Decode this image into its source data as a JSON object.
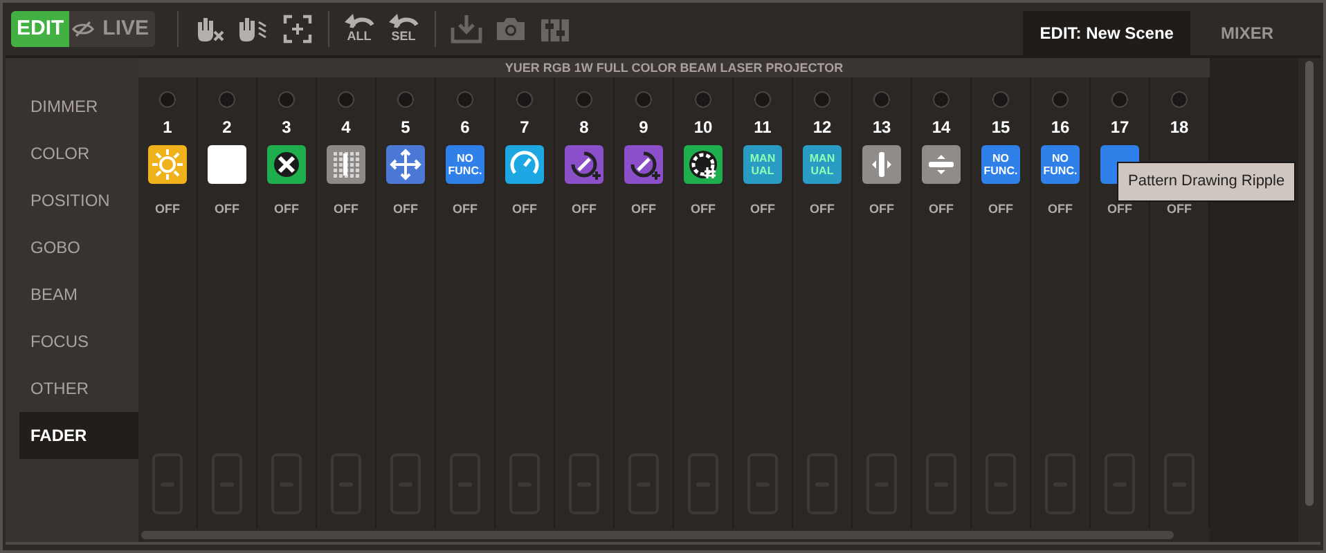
{
  "mode_toggle": [
    {
      "label": "EDIT",
      "kind": "edit",
      "selected": true
    },
    {
      "label": "LIVE",
      "kind": "live",
      "selected": false
    }
  ],
  "toolbar": [
    {
      "kind": "hand-x",
      "disabled": false
    },
    {
      "kind": "hand-waves",
      "disabled": false
    },
    {
      "kind": "select",
      "disabled": false
    },
    {
      "kind": "undo",
      "label": "ALL",
      "disabled": false
    },
    {
      "kind": "undo",
      "label": "SEL",
      "disabled": false
    },
    {
      "kind": "download",
      "disabled": true
    },
    {
      "kind": "camera",
      "disabled": true
    },
    {
      "kind": "sliders",
      "disabled": true
    }
  ],
  "tabs": [
    {
      "label": "EDIT: New Scene",
      "selected": true
    },
    {
      "label": "MIXER",
      "selected": false
    }
  ],
  "sidebar": {
    "items": [
      {
        "label": "DIMMER",
        "selected": false
      },
      {
        "label": "COLOR",
        "selected": false
      },
      {
        "label": "POSITION",
        "selected": false
      },
      {
        "label": "GOBO",
        "selected": false
      },
      {
        "label": "BEAM",
        "selected": false
      },
      {
        "label": "FOCUS",
        "selected": false
      },
      {
        "label": "OTHER",
        "selected": false
      },
      {
        "label": "FADER",
        "selected": true
      }
    ]
  },
  "fixture_title": "YUER RGB 1W FULL COLOR BEAM LASER PROJECTOR",
  "channels": [
    {
      "number": "1",
      "kind": "sun",
      "value": "OFF"
    },
    {
      "number": "2",
      "kind": "white",
      "value": "OFF"
    },
    {
      "number": "3",
      "kind": "shuffle",
      "value": "OFF"
    },
    {
      "number": "4",
      "kind": "grid",
      "value": "OFF"
    },
    {
      "number": "5",
      "kind": "move",
      "value": "OFF"
    },
    {
      "number": "6",
      "kind": "nofunc",
      "label": "NO FUNC.",
      "value": "OFF"
    },
    {
      "number": "7",
      "kind": "gauge",
      "value": "OFF"
    },
    {
      "number": "8",
      "kind": "resize",
      "value": "OFF"
    },
    {
      "number": "9",
      "kind": "resize",
      "value": "OFF"
    },
    {
      "number": "10",
      "kind": "gobo",
      "value": "OFF"
    },
    {
      "number": "11",
      "kind": "manual",
      "label": "MAN UAL",
      "value": "OFF"
    },
    {
      "number": "12",
      "kind": "manual",
      "label": "MAN UAL",
      "value": "OFF"
    },
    {
      "number": "13",
      "kind": "hslider",
      "value": "OFF"
    },
    {
      "number": "14",
      "kind": "vslider",
      "value": "OFF"
    },
    {
      "number": "15",
      "kind": "nofunc",
      "label": "NO FUNC.",
      "value": "OFF"
    },
    {
      "number": "16",
      "kind": "nofunc",
      "label": "NO FUNC.",
      "value": "OFF"
    },
    {
      "number": "17",
      "kind": "nofunc",
      "value": "OFF"
    },
    {
      "number": "18",
      "value": "OFF"
    }
  ],
  "tooltip": "Pattern Drawing Ripple"
}
